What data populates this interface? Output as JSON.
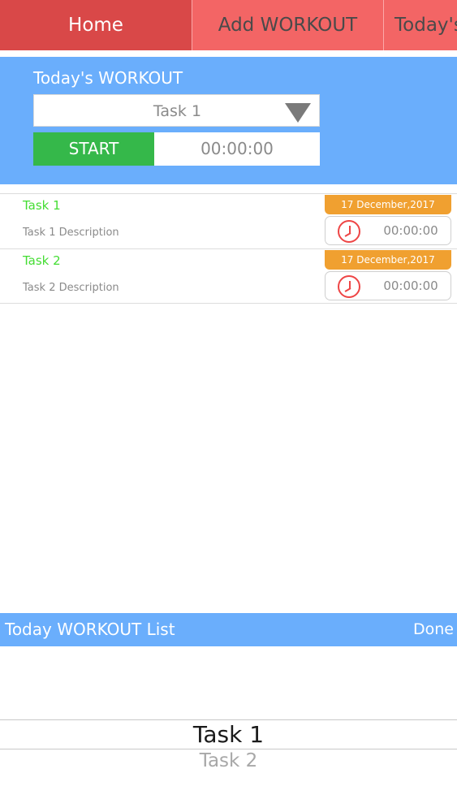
{
  "tabs": [
    {
      "label": "Home",
      "active": true
    },
    {
      "label": "Add WORKOUT",
      "active": false
    },
    {
      "label": "Today's",
      "active": false
    }
  ],
  "workout_panel": {
    "title": "Today's WORKOUT",
    "selected_task": "Task 1",
    "start_label": "START",
    "timer": "00:00:00"
  },
  "tasks": [
    {
      "name": "Task 1",
      "description": "Task  1 Description",
      "date": "17 December,2017",
      "timer": "00:00:00"
    },
    {
      "name": "Task 2",
      "description": "Task 2 Description",
      "date": "17 December,2017",
      "timer": "00:00:00"
    }
  ],
  "picker": {
    "title": "Today WORKOUT List",
    "done_label": "Done",
    "options": [
      "Task 1",
      "Task 2"
    ],
    "selected": "Task 1"
  },
  "icons": {
    "dropdown": "triangle-down-icon",
    "task_timer": "clock-icon"
  },
  "colors": {
    "tab_bar": "#f36565",
    "tab_active": "#d94848",
    "panel": "#6aaefc",
    "start_button": "#35b84a",
    "task_name": "#44dd33",
    "date_badge": "#f0a030",
    "clock": "#ee4545"
  }
}
